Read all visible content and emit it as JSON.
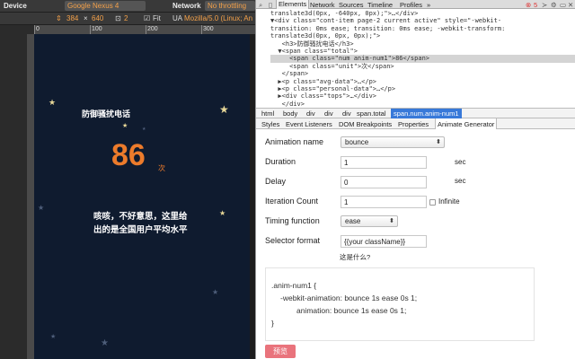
{
  "emulation": {
    "device_label": "Device",
    "device_value": "Google Nexus 4",
    "network_label": "Network",
    "network_value": "No throttling",
    "width": "384",
    "times": "×",
    "height": "640",
    "dpr": "2",
    "fit_label": "Fit",
    "ua_label": "UA",
    "ua_value": "Mozilla/5.0 (Linux; An",
    "ruler_ticks": [
      "0",
      "100",
      "200",
      "300"
    ]
  },
  "page": {
    "title": "防御骚扰电话",
    "number": "86",
    "unit": "次",
    "desc": "咳咳，不好意思，这里给出的是全国用户平均水平",
    "star_color": "#e8d898",
    "number_color": "#ec7b2b",
    "background_color": "#0f1b2f"
  },
  "devtools": {
    "tabs": [
      "Elements",
      "Network",
      "Sources",
      "Timeline",
      "Profiles",
      "»"
    ],
    "active_tab": "Elements",
    "error_count": "5",
    "dom_lines": [
      "translate3d(0px, -640px, 0px);\">…</div>",
      "▼<div class=\"cont-item page-2 current active\" style=\"-webkit-",
      "transition: 0ms ease; transition: 0ms ease; -webkit-transform:",
      "translate3d(0px, 0px, 0px);\">",
      "   <h3>防御骚扰电话</h3>",
      "  ▼<span class=\"total\">",
      "     <span class=\"num anim-num1\">86</span>",
      "     <span class=\"unit\">次</span>",
      "   </span>",
      "  ▶<p class=\"avg-data\">…</p>",
      "  ▶<p class=\"personal-data\">…</p>",
      "  ▶<div class=\"tops\">…</div>",
      "   </div>"
    ],
    "breadcrumbs": [
      "html",
      "body",
      "div",
      "div",
      "div",
      "span.total",
      "span.num.anim-num1"
    ],
    "panel_tabs": [
      "Styles",
      "Event Listeners",
      "DOM Breakpoints",
      "Properties",
      "Animate Generator"
    ],
    "active_panel_tab": "Animate Generator"
  },
  "generator": {
    "animation_name_label": "Animation name",
    "animation_name_value": "bounce",
    "duration_label": "Duration",
    "duration_value": "1",
    "delay_label": "Delay",
    "delay_value": "0",
    "sec_label": "sec",
    "iteration_label": "Iteration Count",
    "iteration_value": "1",
    "infinite_label": "Infinite",
    "timing_label": "Timing function",
    "timing_value": "ease",
    "selector_label": "Selector format",
    "selector_placeholder": "{{your className}}",
    "help_text": "这是什么?",
    "code_line1": ".anim-num1 {",
    "code_line2": "-webkit-animation: bounce 1s ease 0s 1;",
    "code_line3": "animation: bounce 1s ease 0s 1;",
    "code_line4": "}",
    "preview_label": "预览",
    "preview_color": "#e9737c"
  }
}
